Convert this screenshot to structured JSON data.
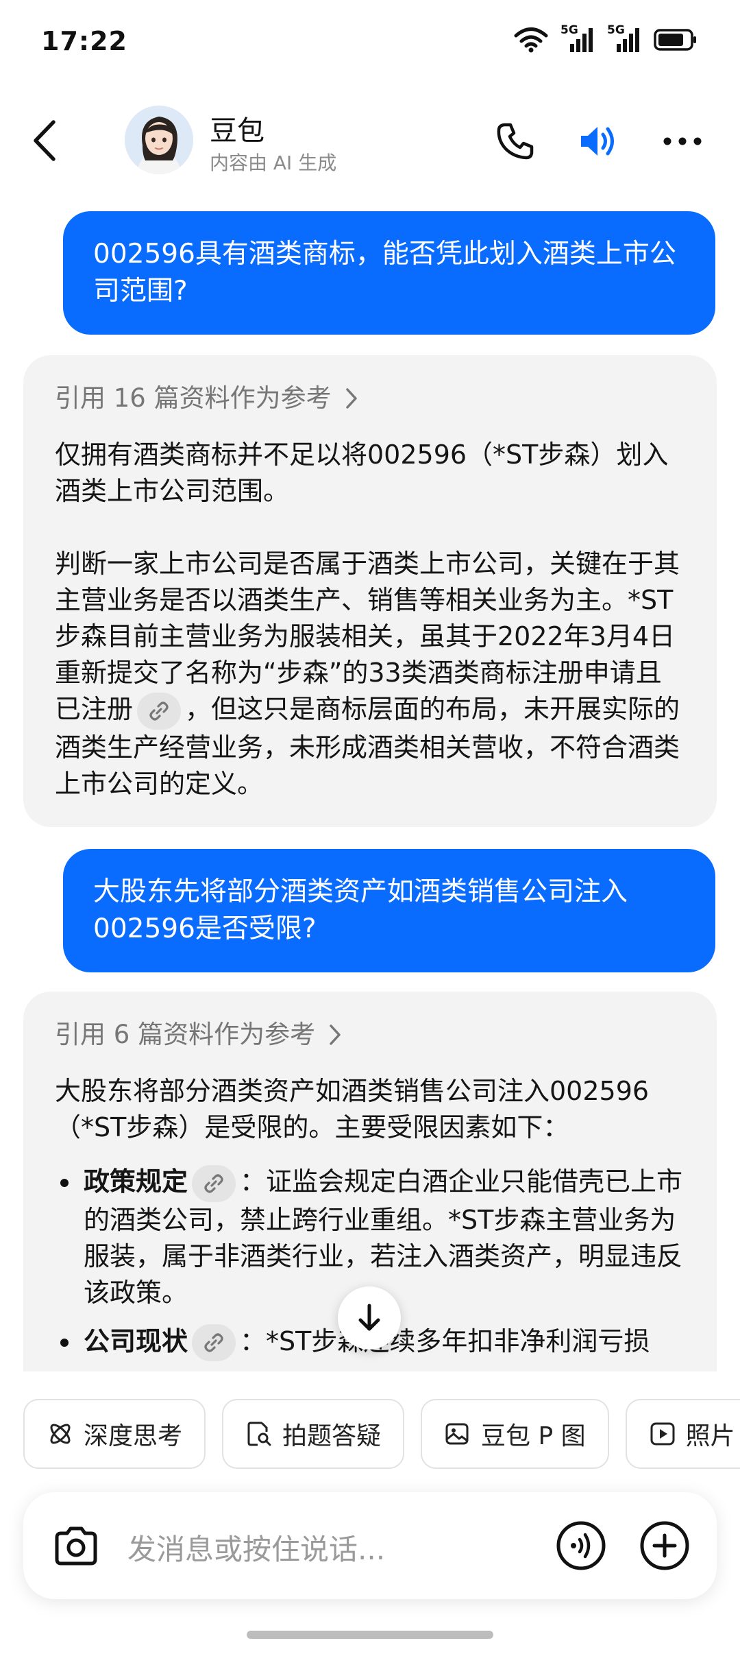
{
  "status_bar": {
    "time": "17:22",
    "net1": "5G",
    "net2": "5G"
  },
  "header": {
    "name": "豆包",
    "subtitle": "内容由 AI 生成"
  },
  "messages": {
    "q1": "002596具有酒类商标，能否凭此划入酒类上市公司范围?",
    "a1": {
      "ref": "引用 16 篇资料作为参考",
      "p1": "仅拥有酒类商标并不足以将002596（*ST步森）划入酒类上市公司范围。",
      "p2a": "判断一家上市公司是否属于酒类上市公司，关键在于其主营业务是否以酒类生产、销售等相关业务为主。*ST步森目前主营业务为服装相关，虽其于2022年3月4日重新提交了名称为“步森”的33类酒类商标注册申请且已注册",
      "p2b": "，但这只是商标层面的布局，未开展实际的酒类生产经营业务，未形成酒类相关营收，不符合酒类上市公司的定义。"
    },
    "q2": "大股东先将部分酒类资产如酒类销售公司注入002596是否受限?",
    "a2": {
      "ref": "引用 6 篇资料作为参考",
      "intro": "大股东将部分酒类资产如酒类销售公司注入002596（*ST步森）是受限的。主要受限因素如下：",
      "b1_title": "政策规定",
      "b1_text": "：证监会规定白酒企业只能借壳已上市的酒类公司，禁止跨行业重组。*ST步森主营业务为服装，属于非酒类行业，若注入酒类资产，明显违反该政策。",
      "b2_title": "公司现状",
      "b2_text": "：*ST步森连续多年扣非净利润亏损"
    }
  },
  "chips": [
    "深度思考",
    "拍题答疑",
    "豆包 P 图",
    "照片"
  ],
  "input": {
    "placeholder": "发消息或按住说话..."
  },
  "colors": {
    "accent": "#0a6cff",
    "ai_bubble": "#f3f3f3"
  },
  "icons": [
    "back-icon",
    "phone-icon",
    "speaker-icon",
    "more-icon",
    "link-icon",
    "camera-icon",
    "voice-icon",
    "plus-icon",
    "arrow-down-icon"
  ]
}
